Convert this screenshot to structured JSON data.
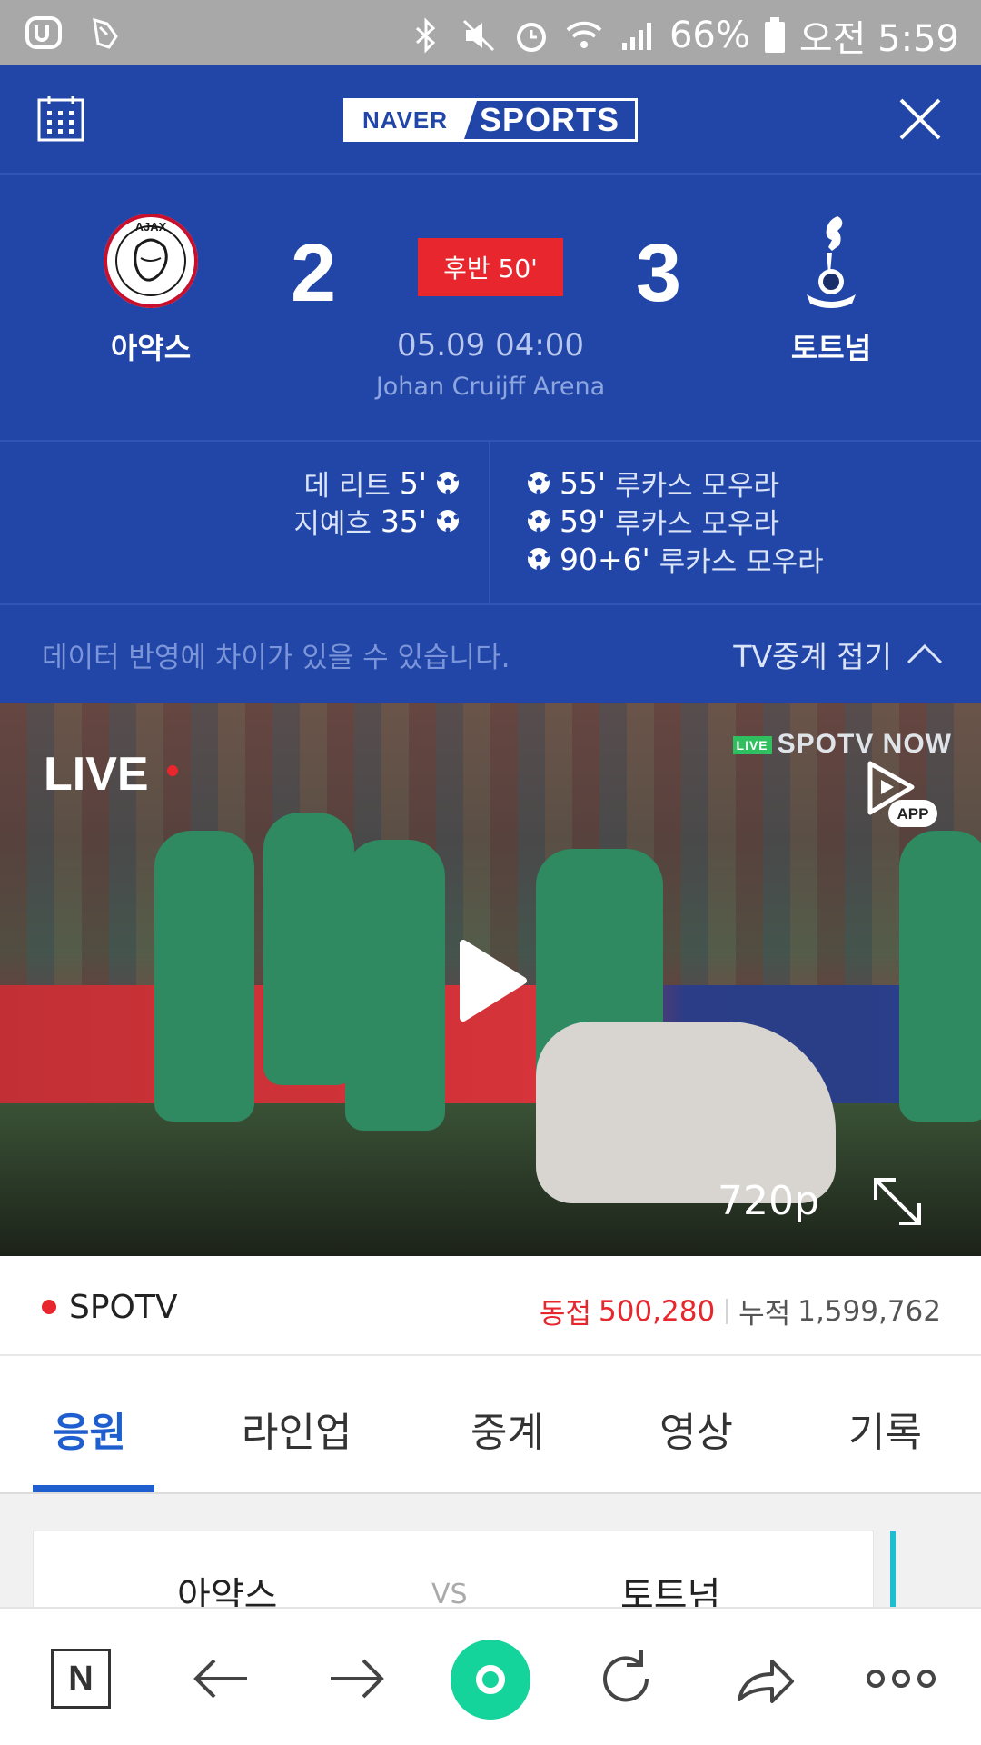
{
  "status_bar": {
    "battery": "66%",
    "time": "오전 5:59"
  },
  "header": {
    "logo_left": "NAVER",
    "logo_right": "SPORTS"
  },
  "match": {
    "home": {
      "name": "아약스",
      "score": "2",
      "crest_text": "AJAX"
    },
    "away": {
      "name": "토트넘",
      "score": "3"
    },
    "status": "후반 50'",
    "datetime": "05.09 04:00",
    "venue": "Johan Cruijff Arena"
  },
  "scorers": {
    "home": [
      {
        "name": "데 리트",
        "minute": "5'"
      },
      {
        "name": "지예흐",
        "minute": "35'"
      }
    ],
    "away": [
      {
        "minute": "55'",
        "name": "루카스 모우라"
      },
      {
        "minute": "59'",
        "name": "루카스 모우라"
      },
      {
        "minute": "90+6'",
        "name": "루카스 모우라"
      }
    ]
  },
  "notice": {
    "text": "데이터 반영에 차이가 있을 수 있습니다.",
    "toggle_label": "TV중계 접기"
  },
  "video": {
    "live_label": "LIVE",
    "live_badge": "LIVE",
    "provider_logo": "SPOTV NOW",
    "app_label": "APP",
    "quality": "720p"
  },
  "channel": {
    "name": "SPOTV",
    "concurrent_label": "동접",
    "concurrent": "500,280",
    "total_label": "누적",
    "total": "1,599,762"
  },
  "tabs": [
    {
      "label": "응원",
      "active": true
    },
    {
      "label": "라인업",
      "active": false
    },
    {
      "label": "중계",
      "active": false
    },
    {
      "label": "영상",
      "active": false
    },
    {
      "label": "기록",
      "active": false
    }
  ],
  "cheer_card": {
    "home": "아약스",
    "vs": "VS",
    "away": "토트넘"
  },
  "bottom_nav": {
    "n_label": "N"
  },
  "colors": {
    "primary_blue": "#2146a8",
    "live_red": "#e8262d",
    "tab_active": "#1e5ecf",
    "home_green": "#15d49b"
  }
}
